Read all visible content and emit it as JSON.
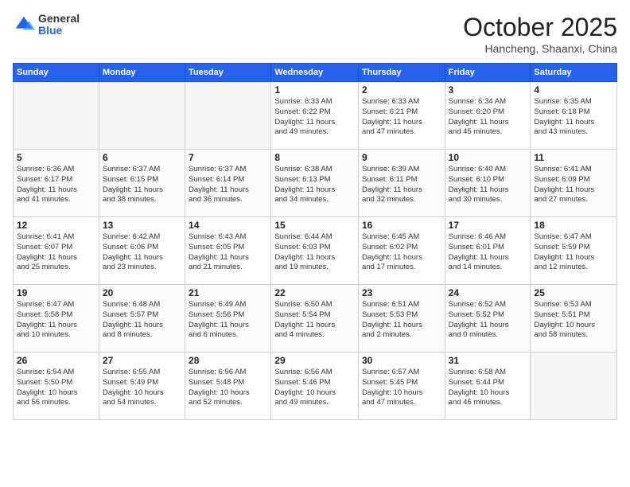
{
  "header": {
    "logo_general": "General",
    "logo_blue": "Blue",
    "month_title": "October 2025",
    "location": "Hancheng, Shaanxi, China"
  },
  "calendar": {
    "days_of_week": [
      "Sunday",
      "Monday",
      "Tuesday",
      "Wednesday",
      "Thursday",
      "Friday",
      "Saturday"
    ],
    "weeks": [
      [
        {
          "day": "",
          "info": ""
        },
        {
          "day": "",
          "info": ""
        },
        {
          "day": "",
          "info": ""
        },
        {
          "day": "1",
          "info": "Sunrise: 6:33 AM\nSunset: 6:22 PM\nDaylight: 11 hours\nand 49 minutes."
        },
        {
          "day": "2",
          "info": "Sunrise: 6:33 AM\nSunset: 6:21 PM\nDaylight: 11 hours\nand 47 minutes."
        },
        {
          "day": "3",
          "info": "Sunrise: 6:34 AM\nSunset: 6:20 PM\nDaylight: 11 hours\nand 45 minutes."
        },
        {
          "day": "4",
          "info": "Sunrise: 6:35 AM\nSunset: 6:18 PM\nDaylight: 11 hours\nand 43 minutes."
        }
      ],
      [
        {
          "day": "5",
          "info": "Sunrise: 6:36 AM\nSunset: 6:17 PM\nDaylight: 11 hours\nand 41 minutes."
        },
        {
          "day": "6",
          "info": "Sunrise: 6:37 AM\nSunset: 6:15 PM\nDaylight: 11 hours\nand 38 minutes."
        },
        {
          "day": "7",
          "info": "Sunrise: 6:37 AM\nSunset: 6:14 PM\nDaylight: 11 hours\nand 36 minutes."
        },
        {
          "day": "8",
          "info": "Sunrise: 6:38 AM\nSunset: 6:13 PM\nDaylight: 11 hours\nand 34 minutes."
        },
        {
          "day": "9",
          "info": "Sunrise: 6:39 AM\nSunset: 6:11 PM\nDaylight: 11 hours\nand 32 minutes."
        },
        {
          "day": "10",
          "info": "Sunrise: 6:40 AM\nSunset: 6:10 PM\nDaylight: 11 hours\nand 30 minutes."
        },
        {
          "day": "11",
          "info": "Sunrise: 6:41 AM\nSunset: 6:09 PM\nDaylight: 11 hours\nand 27 minutes."
        }
      ],
      [
        {
          "day": "12",
          "info": "Sunrise: 6:41 AM\nSunset: 6:07 PM\nDaylight: 11 hours\nand 25 minutes."
        },
        {
          "day": "13",
          "info": "Sunrise: 6:42 AM\nSunset: 6:06 PM\nDaylight: 11 hours\nand 23 minutes."
        },
        {
          "day": "14",
          "info": "Sunrise: 6:43 AM\nSunset: 6:05 PM\nDaylight: 11 hours\nand 21 minutes."
        },
        {
          "day": "15",
          "info": "Sunrise: 6:44 AM\nSunset: 6:03 PM\nDaylight: 11 hours\nand 19 minutes."
        },
        {
          "day": "16",
          "info": "Sunrise: 6:45 AM\nSunset: 6:02 PM\nDaylight: 11 hours\nand 17 minutes."
        },
        {
          "day": "17",
          "info": "Sunrise: 6:46 AM\nSunset: 6:01 PM\nDaylight: 11 hours\nand 14 minutes."
        },
        {
          "day": "18",
          "info": "Sunrise: 6:47 AM\nSunset: 5:59 PM\nDaylight: 11 hours\nand 12 minutes."
        }
      ],
      [
        {
          "day": "19",
          "info": "Sunrise: 6:47 AM\nSunset: 5:58 PM\nDaylight: 11 hours\nand 10 minutes."
        },
        {
          "day": "20",
          "info": "Sunrise: 6:48 AM\nSunset: 5:57 PM\nDaylight: 11 hours\nand 8 minutes."
        },
        {
          "day": "21",
          "info": "Sunrise: 6:49 AM\nSunset: 5:56 PM\nDaylight: 11 hours\nand 6 minutes."
        },
        {
          "day": "22",
          "info": "Sunrise: 6:50 AM\nSunset: 5:54 PM\nDaylight: 11 hours\nand 4 minutes."
        },
        {
          "day": "23",
          "info": "Sunrise: 6:51 AM\nSunset: 5:53 PM\nDaylight: 11 hours\nand 2 minutes."
        },
        {
          "day": "24",
          "info": "Sunrise: 6:52 AM\nSunset: 5:52 PM\nDaylight: 11 hours\nand 0 minutes."
        },
        {
          "day": "25",
          "info": "Sunrise: 6:53 AM\nSunset: 5:51 PM\nDaylight: 10 hours\nand 58 minutes."
        }
      ],
      [
        {
          "day": "26",
          "info": "Sunrise: 6:54 AM\nSunset: 5:50 PM\nDaylight: 10 hours\nand 56 minutes."
        },
        {
          "day": "27",
          "info": "Sunrise: 6:55 AM\nSunset: 5:49 PM\nDaylight: 10 hours\nand 54 minutes."
        },
        {
          "day": "28",
          "info": "Sunrise: 6:56 AM\nSunset: 5:48 PM\nDaylight: 10 hours\nand 52 minutes."
        },
        {
          "day": "29",
          "info": "Sunrise: 6:56 AM\nSunset: 5:46 PM\nDaylight: 10 hours\nand 49 minutes."
        },
        {
          "day": "30",
          "info": "Sunrise: 6:57 AM\nSunset: 5:45 PM\nDaylight: 10 hours\nand 47 minutes."
        },
        {
          "day": "31",
          "info": "Sunrise: 6:58 AM\nSunset: 5:44 PM\nDaylight: 10 hours\nand 46 minutes."
        },
        {
          "day": "",
          "info": ""
        }
      ]
    ]
  }
}
